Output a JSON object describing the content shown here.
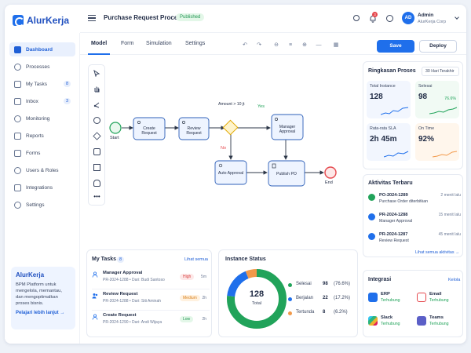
{
  "app": {
    "logo_text": "AlurKerja",
    "page_title": "Purchase Request Process",
    "status_badge": "Published"
  },
  "user": {
    "initials": "AD",
    "name": "Admin",
    "org": "AlurKerja Corp",
    "notifications": "3"
  },
  "sidebar": {
    "items": [
      {
        "label": "Dashboard",
        "badge": ""
      },
      {
        "label": "Processes",
        "badge": ""
      },
      {
        "label": "My Tasks",
        "badge": "8"
      },
      {
        "label": "Inbox",
        "badge": "3"
      },
      {
        "label": "Monitoring",
        "badge": ""
      },
      {
        "label": "Reports",
        "badge": ""
      },
      {
        "label": "Forms",
        "badge": ""
      },
      {
        "label": "Users & Roles",
        "badge": ""
      },
      {
        "label": "Integrations",
        "badge": ""
      },
      {
        "label": "Settings",
        "badge": ""
      }
    ],
    "promo": {
      "title": "AlurKerja",
      "text": "BPM Platform untuk mengelola, memantau, dan mengoptimalkan proses bisnis.",
      "link": "Pelajari lebih lanjut →"
    }
  },
  "tabs": [
    "Model",
    "Form",
    "Simulation",
    "Settings"
  ],
  "actions": {
    "save": "Save",
    "deploy": "Deploy"
  },
  "diagram": {
    "start": "Start",
    "end": "End",
    "create": "Create Request",
    "review": "Review Request",
    "gateway_label": "Amount > 10 jt",
    "yes": "Yes",
    "no": "No",
    "manager": "Manager Approval",
    "auto": "Auto Approval",
    "publish": "Publish PO"
  },
  "summary": {
    "title": "Ringkasan Proses",
    "period": "30 Hari Terakhir",
    "metrics": [
      {
        "label": "Total Instance",
        "value": "128",
        "pct": ""
      },
      {
        "label": "Selesai",
        "value": "98",
        "pct": "76.6%"
      },
      {
        "label": "Rata-rata SLA",
        "value": "2h 45m",
        "pct": ""
      },
      {
        "label": "On Time",
        "value": "92%",
        "pct": ""
      }
    ],
    "colors": {
      "blue": "#1f6feb",
      "green": "#21a35a",
      "orange": "#f2994a"
    }
  },
  "activity": {
    "title": "Aktivitas Terbaru",
    "items": [
      {
        "id": "PO-2024-1289",
        "desc": "Purchase Order diterbitkan",
        "time": "2 menit lalu"
      },
      {
        "id": "PR-2024-1288",
        "desc": "Manager Approval",
        "time": "15 menit lalu"
      },
      {
        "id": "PR-2024-1287",
        "desc": "Review Request",
        "time": "45 menit lalu"
      }
    ],
    "see_all": "Lihat semua aktivitas →"
  },
  "integrations": {
    "title": "Integrasi",
    "link": "Kelola",
    "items": [
      {
        "name": "ERP",
        "status": "Terhubung"
      },
      {
        "name": "Email",
        "status": "Terhubung"
      },
      {
        "name": "Slack",
        "status": "Terhubung"
      },
      {
        "name": "Teams",
        "status": "Terhubung"
      }
    ]
  },
  "my_tasks": {
    "title": "My Tasks",
    "count": "8",
    "see_all": "Lihat semua",
    "items": [
      {
        "name": "Manager Approval",
        "meta": "PR-2024-1288  •  Dari: Budi Santoso",
        "priority": "High",
        "time": "5m"
      },
      {
        "name": "Review Request",
        "meta": "PR-2024-1288  •  Dari: Siti Aminah",
        "priority": "Medium",
        "time": "2h"
      },
      {
        "name": "Create Request",
        "meta": "PR-2024-1290  •  Dari: Andi Wijaya",
        "priority": "Low",
        "time": "2h"
      }
    ]
  },
  "instance_status": {
    "title": "Instance Status",
    "total_value": "128",
    "total_label": "Total",
    "rows": [
      {
        "label": "Selesai",
        "value": 98,
        "pct": "(76.6%)",
        "color": "#21a35a"
      },
      {
        "label": "Berjalan",
        "value": 22,
        "pct": "(17.2%)",
        "color": "#1f6feb"
      },
      {
        "label": "Tertunda",
        "value": 8,
        "pct": "(6.2%)",
        "color": "#f2994a"
      }
    ]
  },
  "chart_data": {
    "type": "pie",
    "categories": [
      "Selesai",
      "Berjalan",
      "Tertunda"
    ],
    "values": [
      98,
      22,
      8
    ],
    "title": "Instance Status"
  }
}
